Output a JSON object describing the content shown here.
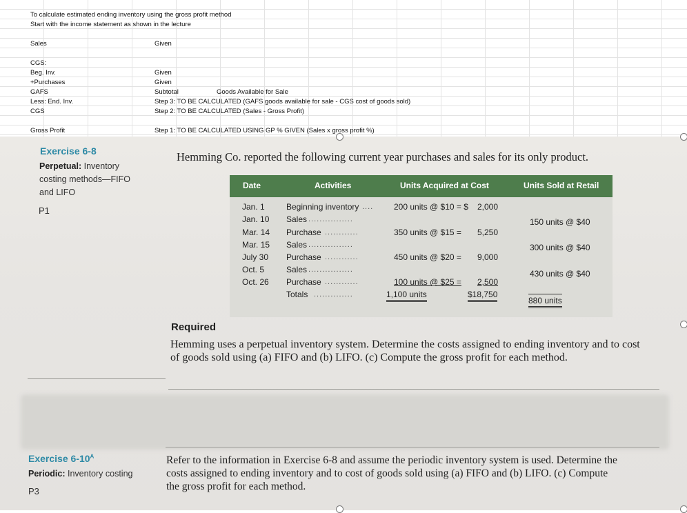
{
  "sheet": {
    "note1": "To calculate estimated ending inventory using the gross profit method",
    "note2": "Start with the income statement as shown in the lecture",
    "rows": [
      {
        "label": "Sales",
        "value": "Given",
        "extra": ""
      },
      {
        "label": "CGS:",
        "value": "",
        "extra": ""
      },
      {
        "label": "Beg. Inv.",
        "value": "Given",
        "extra": ""
      },
      {
        "label": "+Purchases",
        "value": "Given",
        "extra": ""
      },
      {
        "label": "GAFS",
        "value": "Subtotal",
        "extra": "Goods Available for Sale"
      },
      {
        "label": "Less: End. Inv.",
        "value": "Step 3: TO BE CALCULATED (GAFS goods available for sale - CGS cost of goods sold)",
        "extra": ""
      },
      {
        "label": "CGS",
        "value": "Step 2: TO BE CALCULATED (Sales - Gross Profit)",
        "extra": ""
      },
      {
        "label": "Gross Profit",
        "value": "Step 1: TO BE CALCULATED USING GP % GIVEN (Sales x gross profit %)",
        "extra": ""
      }
    ]
  },
  "exercise68": {
    "title": "Exercise 6-8",
    "sub_bold": "Perpetual:",
    "sub_rest": "Inventory",
    "sub_line2": "costing methods—FIFO",
    "sub_line3": "and LIFO",
    "code": "P1",
    "intro": "Hemming Co. reported the following current year purchases and sales for its only product."
  },
  "table": {
    "headers": [
      "Date",
      "Activities",
      "Units Acquired at Cost",
      "Units Sold at Retail"
    ],
    "rows": [
      {
        "date": "Jan.  1",
        "activity": "Beginning inventory",
        "acquired": "200 units @ $10 = $",
        "cost": "2,000",
        "sold": ""
      },
      {
        "date": "Jan. 10",
        "activity": "Sales",
        "acquired": "",
        "cost": "",
        "sold": "150 units @ $40"
      },
      {
        "date": "Mar. 14",
        "activity": "Purchase",
        "acquired": "350 units @ $15 =",
        "cost": "5,250",
        "sold": ""
      },
      {
        "date": "Mar. 15",
        "activity": "Sales",
        "acquired": "",
        "cost": "",
        "sold": "300 units @ $40"
      },
      {
        "date": "July 30",
        "activity": "Purchase",
        "acquired": "450 units @ $20 =",
        "cost": "9,000",
        "sold": ""
      },
      {
        "date": "Oct.  5",
        "activity": "Sales",
        "acquired": "",
        "cost": "",
        "sold": "430 units @ $40"
      },
      {
        "date": "Oct. 26",
        "activity": "Purchase",
        "acquired": "100 units @ $25 =",
        "cost": "2,500",
        "sold": ""
      },
      {
        "date": "",
        "activity": "Totals",
        "acquired": "1,100 units",
        "cost": "$18,750",
        "sold": "880 units"
      }
    ]
  },
  "required": {
    "title": "Required",
    "line1": "Hemming uses a perpetual inventory system. Determine the costs assigned to ending inventory and to cost",
    "line2": "of goods sold using (a) FIFO and (b) LIFO. (c) Compute the gross profit for each method."
  },
  "exercise610": {
    "title": "Exercise 6-10",
    "title_sup": "A",
    "sub_bold": "Periodic:",
    "sub_rest": "Inventory costing",
    "code": "P3",
    "line1": "Refer to the information in Exercise 6-8 and assume the periodic inventory system is used. Determine the",
    "line2": "costs assigned to ending inventory and to cost of goods sold using (a) FIFO and (b) LIFO. (c) Compute",
    "line3": "the gross profit for each method."
  },
  "colors": {
    "accent": "#2e8aa6",
    "table_header": "#4e7d4c"
  }
}
